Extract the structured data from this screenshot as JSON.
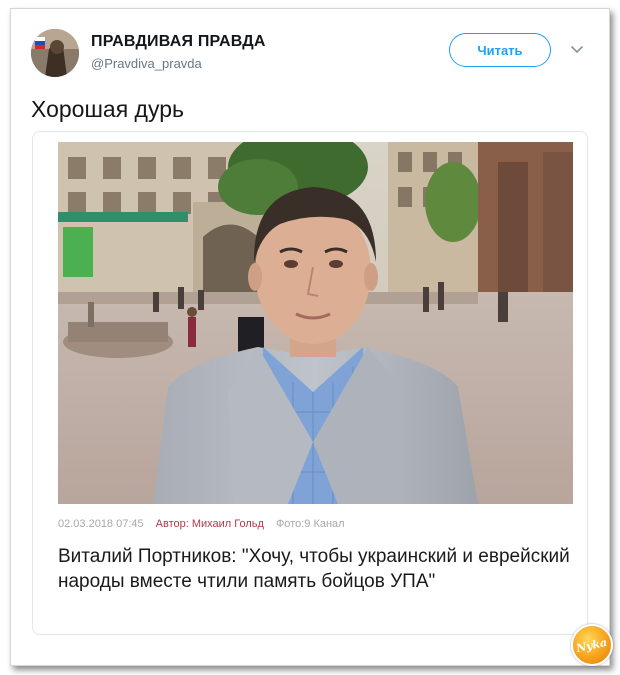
{
  "tweet": {
    "author_name": "ПРАВДИВАЯ ПРАВДА",
    "handle": "@Pravdiva_pravda",
    "follow_label": "Читать",
    "text": "Хорошая дурь",
    "menu_icon": "chevron-down-icon"
  },
  "card": {
    "date": "02.03.2018 07:45",
    "author": "Автор: Михаил Гольд",
    "photo_credit": "Фото:9 Канал",
    "headline": "Виталий Портников: \"Хочу, чтобы украинский и еврейский народы вместе чтили память бойцов УПА\""
  },
  "watermark": {
    "text": "Nyka"
  },
  "colors": {
    "accent": "#1da1f2",
    "author_red": "#b03a46",
    "muted": "#657786"
  }
}
